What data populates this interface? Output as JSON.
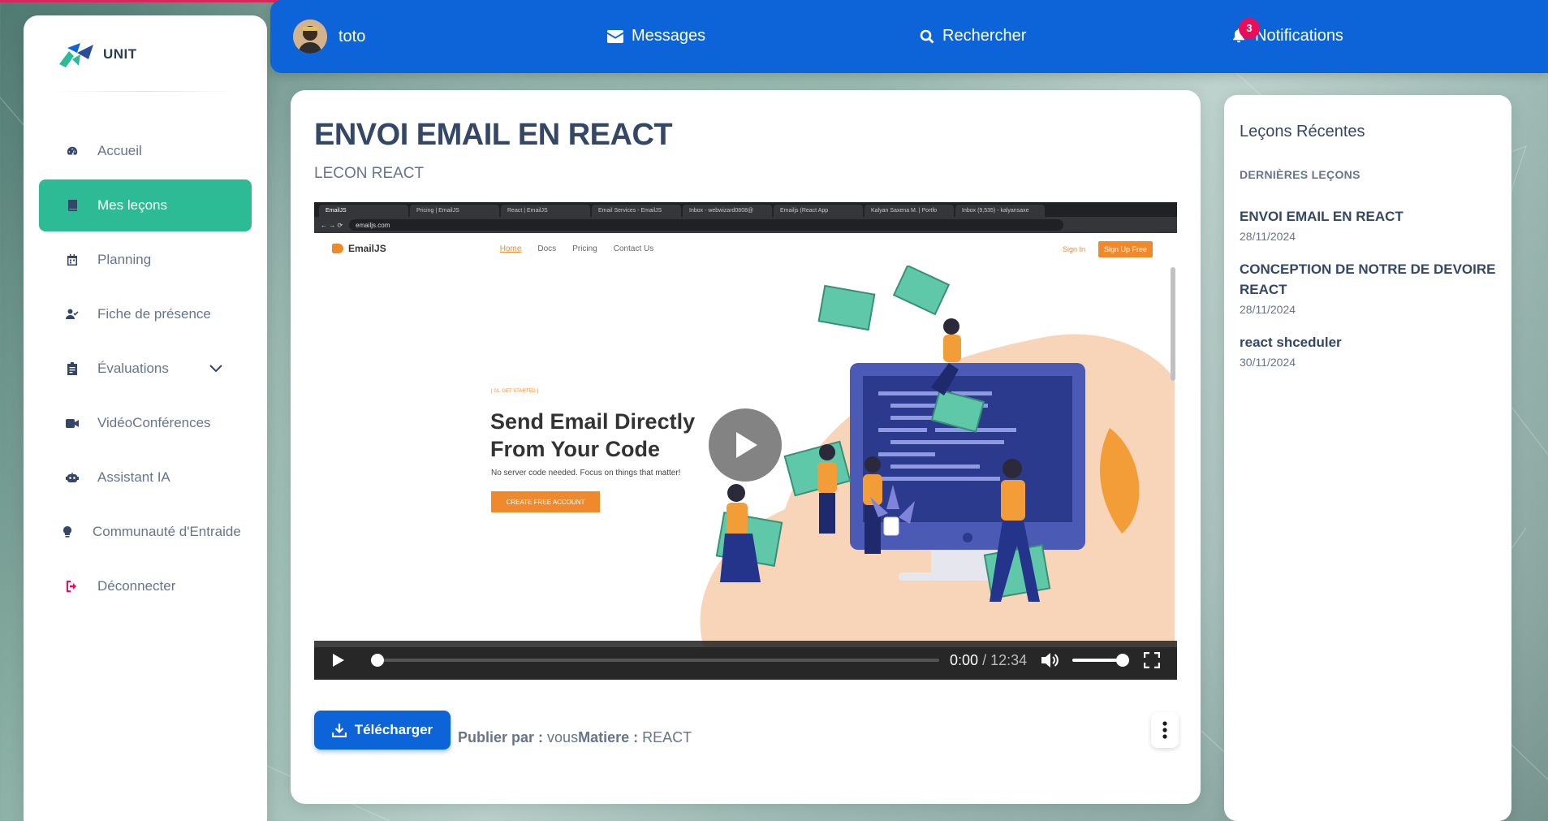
{
  "brand": {
    "name": "UNIT"
  },
  "sidebar": {
    "items": [
      {
        "label": "Accueil",
        "icon": "dashboard-icon",
        "active": false
      },
      {
        "label": "Mes leçons",
        "icon": "book-icon",
        "active": true
      },
      {
        "label": "Planning",
        "icon": "calendar-icon",
        "active": false
      },
      {
        "label": "Fiche de présence",
        "icon": "user-check-icon",
        "active": false
      },
      {
        "label": "Évaluations",
        "icon": "clipboard-icon",
        "active": false
      },
      {
        "label": "VidéoConférences",
        "icon": "video-icon",
        "active": false
      },
      {
        "label": "Assistant IA",
        "icon": "robot-icon",
        "active": false
      },
      {
        "label": "Communauté d'Entraide",
        "icon": "lightbulb-icon",
        "active": false
      },
      {
        "label": "Déconnecter",
        "icon": "logout-icon",
        "active": false
      }
    ]
  },
  "header": {
    "username": "toto",
    "messages": "Messages",
    "search": "Rechercher",
    "notifications": "Notifications",
    "notif_count": "3"
  },
  "lesson": {
    "title": "ENVOI EMAIL EN REACT",
    "subtitle": "LECON REACT",
    "download_label": "Télécharger",
    "published_by_label": "Publier par :",
    "published_by": "vous",
    "subject_label": "Matiere :",
    "subject": "REACT"
  },
  "video": {
    "current_time": "0:00",
    "separator": "/",
    "duration": "12:34",
    "progress": 0,
    "volume": 1,
    "browser": {
      "tabs": [
        "EmailJS",
        "Pricing | EmailJS",
        "React | EmailJS",
        "Email Services - EmailJS",
        "Inbox - webwizard0808@",
        "Emailjs (React App",
        "Kalyan Saxena M. | Portfo",
        "Inbox (9,535) - kalyansaxe"
      ],
      "address": "emailjs.com"
    },
    "site": {
      "logo": "EmailJS",
      "nav": [
        "Home",
        "Docs",
        "Pricing",
        "Contact Us"
      ],
      "signin": "Sign In",
      "signup": "Sign Up Free",
      "kicker": "[ 01. GET STARTED ]",
      "headline_1": "Send Email Directly",
      "headline_2": "From Your Code",
      "tagline": "No server code needed. Focus on things that matter!",
      "cta": "CREATE FREE ACCOUNT"
    }
  },
  "recent": {
    "title": "Leçons Récentes",
    "kicker": "DERNIÈRES LEÇONS",
    "items": [
      {
        "title": "ENVOI EMAIL EN REACT",
        "date": "28/11/2024"
      },
      {
        "title": "CONCEPTION DE NOTRE DE DEVOIRE REACT",
        "date": "28/11/2024"
      },
      {
        "title": "react shceduler",
        "date": "30/11/2024"
      }
    ]
  },
  "colors": {
    "primary": "#0d64d9",
    "active_nav": "#2dbb95",
    "accent_red": "#ea0e5a",
    "text_dark": "#344767",
    "text_muted": "#67748e"
  }
}
